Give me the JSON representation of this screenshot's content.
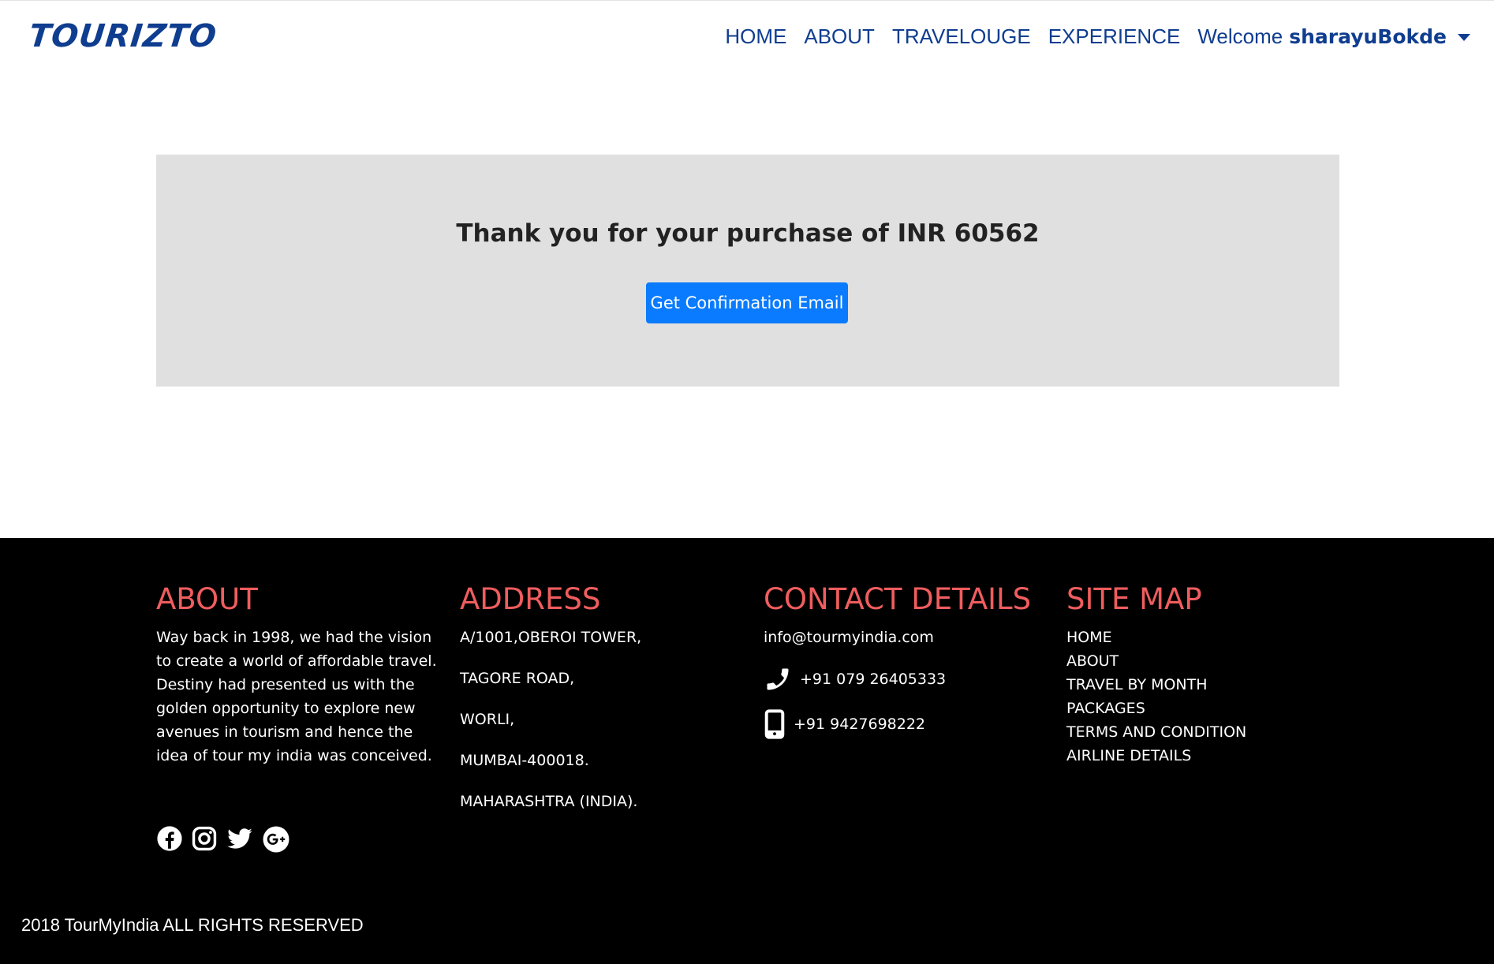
{
  "brand": "TOURIZTO",
  "nav": {
    "items": [
      "HOME",
      "ABOUT",
      "TRAVELOUGE",
      "EXPERIENCE"
    ],
    "welcome": "Welcome",
    "username": "sharayuBokde"
  },
  "main": {
    "message": "Thank you for your purchase of INR 60562",
    "button_label": "Get Confirmation Email"
  },
  "footer": {
    "about": {
      "title": "ABOUT",
      "text": "Way back in 1998, we had the vision to create a world of affordable travel. Destiny had presented us with the golden opportunity to explore new avenues in tourism and hence the idea of tour my india was conceived."
    },
    "address": {
      "title": "ADDRESS",
      "lines": [
        "A/1001,OBEROI TOWER,",
        "TAGORE ROAD,",
        "WORLI,",
        "MUMBAI-400018.",
        "MAHARASHTRA (INDIA)."
      ]
    },
    "contact": {
      "title": "CONTACT DETAILS",
      "email": "info@tourmyindia.com",
      "phone": "+91 079 26405333",
      "mobile": "+91 9427698222"
    },
    "sitemap": {
      "title": "SITE MAP",
      "items": [
        "HOME",
        "ABOUT",
        "TRAVEL BY MONTH",
        "PACKAGES",
        "TERMS AND CONDITION",
        "AIRLINE DETAILS"
      ]
    },
    "social_icons": [
      "facebook-icon",
      "instagram-icon",
      "twitter-icon",
      "google-plus-icon"
    ],
    "copyright": "2018 TourMyIndia ALL RIGHTS RESERVED"
  },
  "colors": {
    "brand": "#0f3d8f",
    "accent": "#f05d5e",
    "button": "#0a7bff",
    "jumbotron_bg": "#e0e0e0",
    "footer_bg": "#000000"
  }
}
